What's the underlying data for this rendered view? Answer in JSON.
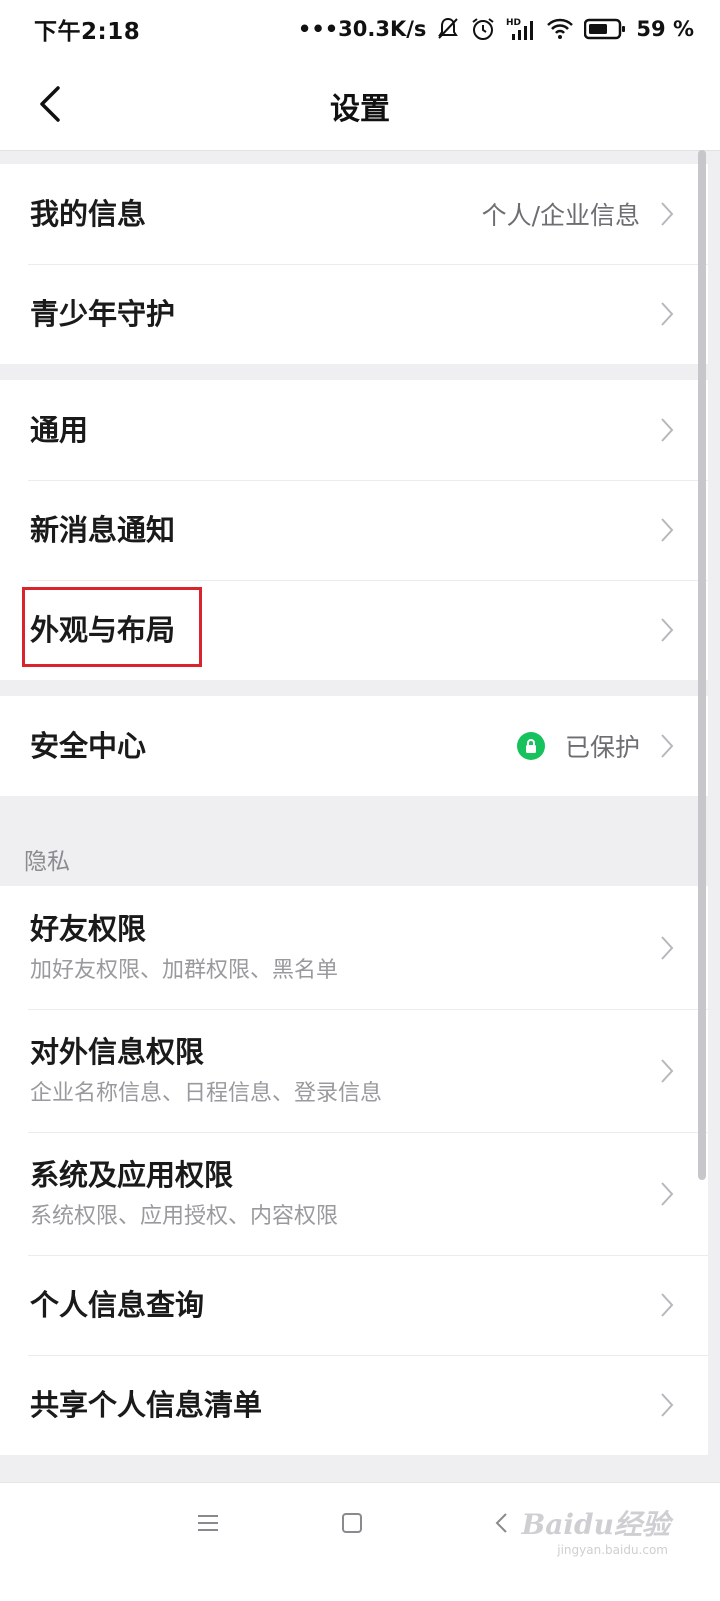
{
  "status_bar": {
    "time": "下午2:18",
    "network_speed": "•••30.3K/s",
    "battery": "59 %",
    "icons": [
      "bell-off-icon",
      "alarm-icon",
      "hd-signal-icon",
      "wifi-icon",
      "battery-icon"
    ]
  },
  "header": {
    "title": "设置",
    "back_icon": "chevron-left-icon"
  },
  "groups": {
    "account": {
      "my_info": {
        "label": "我的信息",
        "value": "个人/企业信息"
      },
      "youth": {
        "label": "青少年守护"
      }
    },
    "general": {
      "general": {
        "label": "通用"
      },
      "notify": {
        "label": "新消息通知"
      },
      "appearance": {
        "label": "外观与布局"
      }
    },
    "security": {
      "center": {
        "label": "安全中心",
        "value": "已保护",
        "status_color": "#17c25c"
      }
    }
  },
  "privacy": {
    "header": "隐私",
    "friend": {
      "label": "好友权限",
      "sub": "加好友权限、加群权限、黑名单"
    },
    "external": {
      "label": "对外信息权限",
      "sub": "企业名称信息、日程信息、登录信息"
    },
    "system": {
      "label": "系统及应用权限",
      "sub": "系统权限、应用授权、内容权限"
    },
    "query": {
      "label": "个人信息查询"
    },
    "shared": {
      "label": "共享个人信息清单"
    }
  },
  "annotation": {
    "color": "#d9242f"
  },
  "bottom_nav": {
    "icons": [
      "menu-icon",
      "home-square-icon",
      "back-arrow-icon"
    ]
  },
  "watermark": {
    "text": "Baidu经验",
    "url": "jingyan.baidu.com"
  }
}
